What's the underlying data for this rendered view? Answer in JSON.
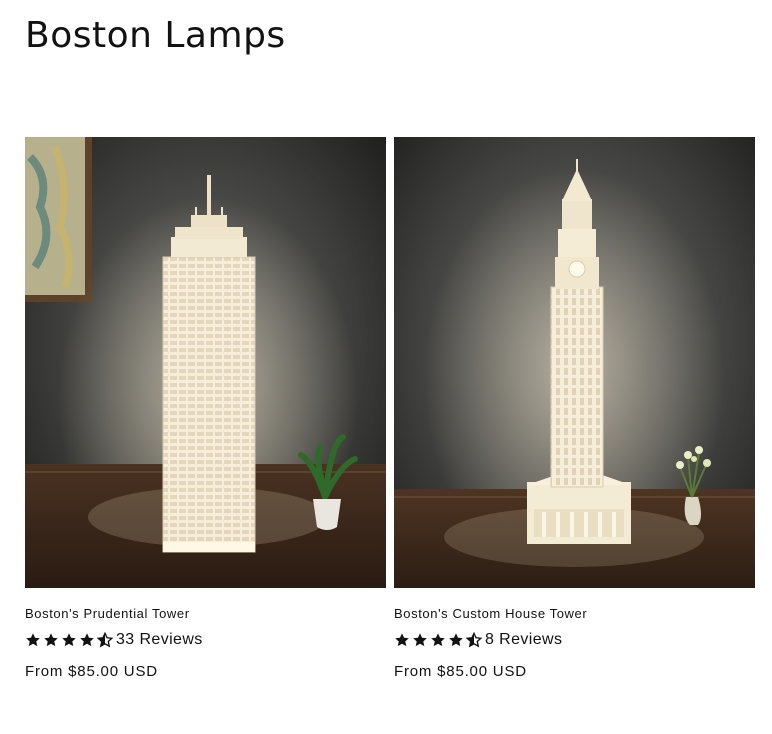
{
  "collection": {
    "title": "Boston Lamps"
  },
  "products": [
    {
      "title": "Boston's Prudential Tower",
      "rating": 4.5,
      "reviews_label": "33 Reviews",
      "price_label": "From $85.00 USD",
      "image_icon": "prudential-tower-lamp-photo"
    },
    {
      "title": "Boston's Custom House Tower",
      "rating": 4.5,
      "reviews_label": "8 Reviews",
      "price_label": "From $85.00 USD",
      "image_icon": "custom-house-tower-lamp-photo"
    }
  ],
  "colors": {
    "text": "#121212",
    "star": "#121212"
  }
}
